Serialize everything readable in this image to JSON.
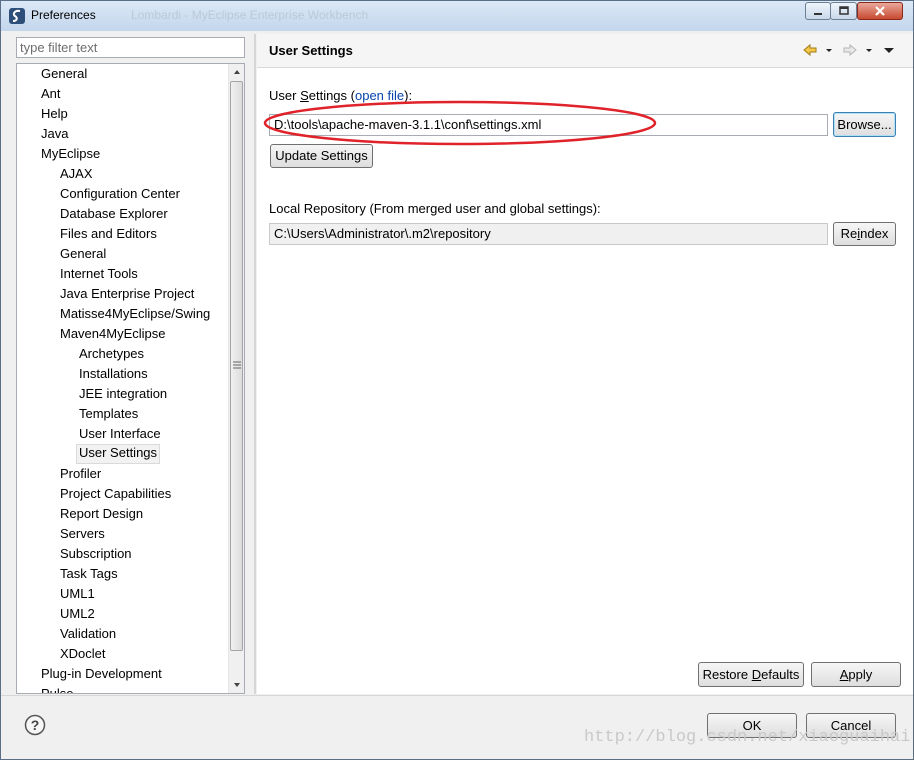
{
  "window": {
    "title": "Preferences",
    "ghost_title": "Lombardi - MyEclipse Enterprise Workbench"
  },
  "filter": {
    "placeholder": "type filter text"
  },
  "tree": {
    "items": [
      "General",
      "Ant",
      "Help",
      "Java",
      "MyEclipse",
      "AJAX",
      "Configuration Center",
      "Database Explorer",
      "Files and Editors",
      "General",
      "Internet Tools",
      "Java Enterprise Project",
      "Matisse4MyEclipse/Swing",
      "Maven4MyEclipse",
      "Archetypes",
      "Installations",
      "JEE integration",
      "Templates",
      "User Interface",
      "User Settings",
      "Profiler",
      "Project Capabilities",
      "Report Design",
      "Servers",
      "Subscription",
      "Task Tags",
      "UML1",
      "UML2",
      "Validation",
      "XDoclet",
      "Plug-in Development",
      "Pulse"
    ],
    "selected": "User Settings"
  },
  "page": {
    "title": "User Settings",
    "user_settings_label_prefix": "User ",
    "user_settings_label_mnemonic": "S",
    "user_settings_label_rest": "ettings (",
    "open_file_link": "open file",
    "user_settings_label_suffix": "):",
    "user_settings_value": "D:\\tools\\apache-maven-3.1.1\\conf\\settings.xml",
    "browse_button": "Browse...",
    "update_settings_button": "Update Settings",
    "local_repo_label": "Local Repository (From merged user and global settings):",
    "local_repo_value": "C:\\Users\\Administrator\\.m2\\repository",
    "reindex_prefix": "Re",
    "reindex_mnemonic": "i",
    "reindex_suffix": "ndex",
    "restore_prefix": "Restore ",
    "restore_mnemonic": "D",
    "restore_suffix": "efaults",
    "apply_mnemonic": "A",
    "apply_suffix": "pply"
  },
  "dialog": {
    "ok_button": "OK",
    "cancel_button": "Cancel"
  },
  "watermark": "http://blog.csdn.net/xiaoguaihai",
  "colors": {
    "annotation": "#e0222a",
    "link": "#0645ad"
  },
  "icons": [
    "app-icon",
    "minimize-icon",
    "maximize-icon",
    "close-icon",
    "back-icon",
    "forward-icon",
    "view-menu-icon",
    "help-icon"
  ]
}
